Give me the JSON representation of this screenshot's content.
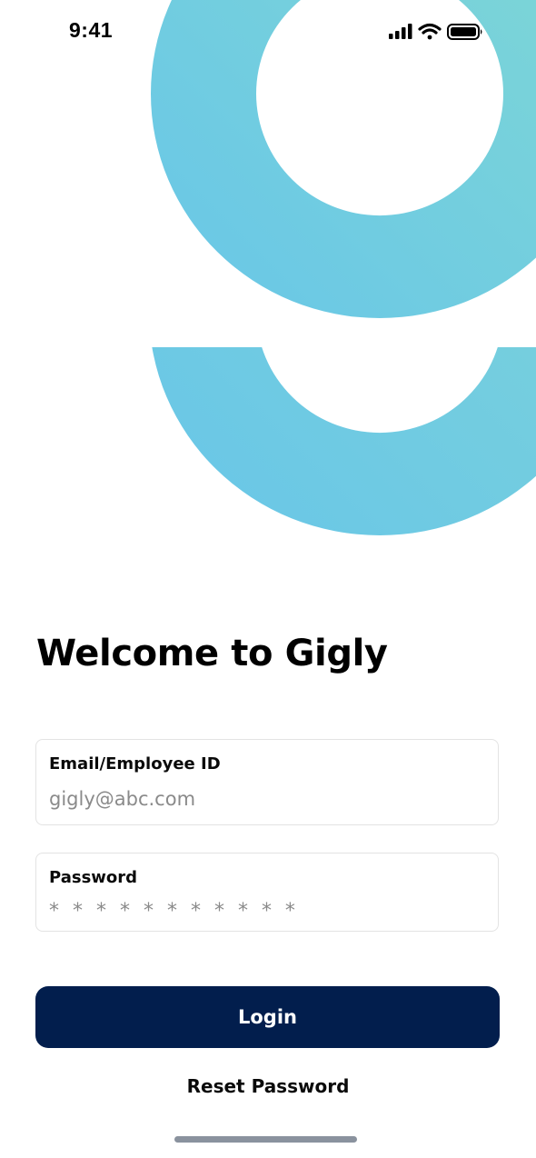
{
  "status_bar": {
    "time": "9:41",
    "icons": [
      "cellular-signal-icon",
      "wifi-icon",
      "battery-icon"
    ]
  },
  "brand": {
    "logo": "gigly-g-logo",
    "gradient_colors": [
      "#6ac6e8",
      "#7ed6d5"
    ]
  },
  "login": {
    "title": "Welcome to Gigly",
    "email": {
      "label": "Email/Employee ID",
      "placeholder": "gigly@abc.com",
      "value": ""
    },
    "password": {
      "label": "Password",
      "placeholder": "* * * * * * * * * * *",
      "value": ""
    },
    "login_label": "Login",
    "reset_label": "Reset Password"
  },
  "colors": {
    "primary_button": "#021e4d",
    "field_border": "#e3e3e3",
    "placeholder_text": "#8a8a8a"
  }
}
